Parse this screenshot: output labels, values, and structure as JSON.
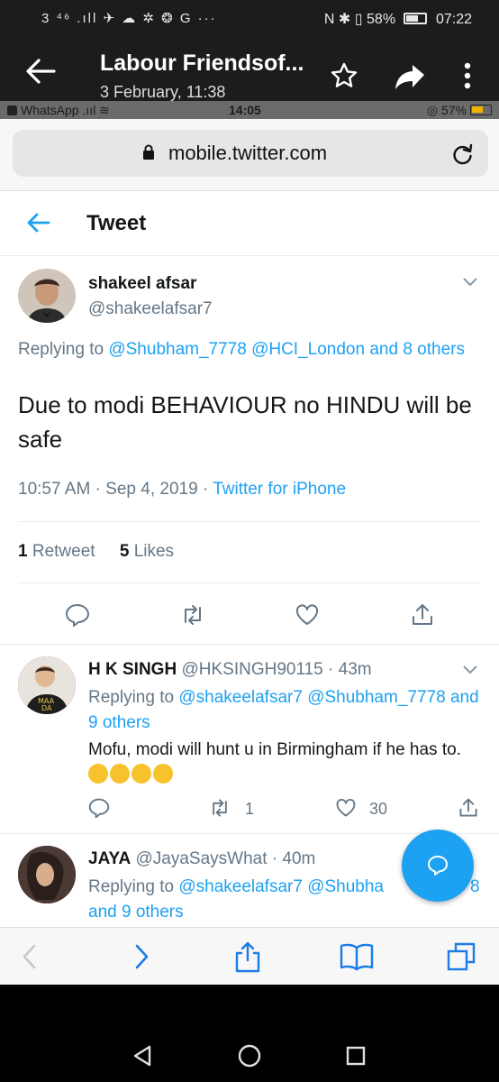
{
  "android_status": {
    "left_icons": "3 ⁴⁶ .ıll ✈ ☁ ✲ ❂ G ···",
    "right_icons": "N ✱ ▯ 58%",
    "time": "07:22"
  },
  "viewer": {
    "title": "Labour Friendsof...",
    "subtitle": "3 February, 11:38"
  },
  "ios_status": {
    "carrier": "WhatsApp",
    "time": "14:05",
    "battery": "57%"
  },
  "safari": {
    "url": "mobile.twitter.com"
  },
  "tweet_page": {
    "header_title": "Tweet",
    "main": {
      "name": "shakeel afsar",
      "handle": "@shakeelafsar7",
      "replying_prefix": "Replying to",
      "replying_to": "@Shubham_7778 @HCI_London and 8 others",
      "text": "Due to modi BEHAVIOUR no HINDU will be safe",
      "time": "10:57 AM · Sep 4, 2019 · ",
      "source": "Twitter for iPhone",
      "retweets_count": "1",
      "retweets_label": "Retweet",
      "likes_count": "5",
      "likes_label": "Likes"
    },
    "reply1": {
      "name": "H K SINGH",
      "handle_time": "@HKSINGH90115 · 43m",
      "replying_prefix": "Replying to",
      "replying_to": "@shakeelafsar7 @Shubham_7778 and 9 others",
      "text": "Mofu, modi will hunt u in Birmingham if he has to.",
      "retweets": "1",
      "likes": "30"
    },
    "reply2": {
      "name": "JAYA",
      "handle_time": "@JayaSaysWhat · 40m",
      "replying_prefix": "Replying to",
      "replying_to": "@shakeelafsar7 @Shubha",
      "replying_tail": "8",
      "replying_line2": "and 9 others"
    }
  },
  "colors": {
    "twitter_blue": "#1da1f2",
    "text_grey": "#657786",
    "ios_blue": "#1a7ce8"
  }
}
